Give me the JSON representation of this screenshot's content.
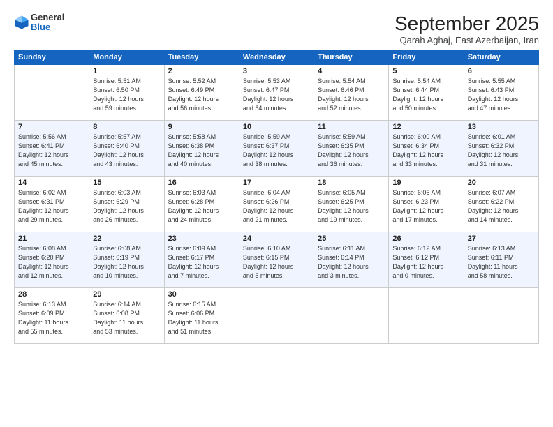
{
  "logo": {
    "general": "General",
    "blue": "Blue"
  },
  "header": {
    "month_year": "September 2025",
    "location": "Qarah Aghaj, East Azerbaijan, Iran"
  },
  "days_of_week": [
    "Sunday",
    "Monday",
    "Tuesday",
    "Wednesday",
    "Thursday",
    "Friday",
    "Saturday"
  ],
  "weeks": [
    [
      {
        "day": "",
        "info": ""
      },
      {
        "day": "1",
        "info": "Sunrise: 5:51 AM\nSunset: 6:50 PM\nDaylight: 12 hours\nand 59 minutes."
      },
      {
        "day": "2",
        "info": "Sunrise: 5:52 AM\nSunset: 6:49 PM\nDaylight: 12 hours\nand 56 minutes."
      },
      {
        "day": "3",
        "info": "Sunrise: 5:53 AM\nSunset: 6:47 PM\nDaylight: 12 hours\nand 54 minutes."
      },
      {
        "day": "4",
        "info": "Sunrise: 5:54 AM\nSunset: 6:46 PM\nDaylight: 12 hours\nand 52 minutes."
      },
      {
        "day": "5",
        "info": "Sunrise: 5:54 AM\nSunset: 6:44 PM\nDaylight: 12 hours\nand 50 minutes."
      },
      {
        "day": "6",
        "info": "Sunrise: 5:55 AM\nSunset: 6:43 PM\nDaylight: 12 hours\nand 47 minutes."
      }
    ],
    [
      {
        "day": "7",
        "info": "Sunrise: 5:56 AM\nSunset: 6:41 PM\nDaylight: 12 hours\nand 45 minutes."
      },
      {
        "day": "8",
        "info": "Sunrise: 5:57 AM\nSunset: 6:40 PM\nDaylight: 12 hours\nand 43 minutes."
      },
      {
        "day": "9",
        "info": "Sunrise: 5:58 AM\nSunset: 6:38 PM\nDaylight: 12 hours\nand 40 minutes."
      },
      {
        "day": "10",
        "info": "Sunrise: 5:59 AM\nSunset: 6:37 PM\nDaylight: 12 hours\nand 38 minutes."
      },
      {
        "day": "11",
        "info": "Sunrise: 5:59 AM\nSunset: 6:35 PM\nDaylight: 12 hours\nand 36 minutes."
      },
      {
        "day": "12",
        "info": "Sunrise: 6:00 AM\nSunset: 6:34 PM\nDaylight: 12 hours\nand 33 minutes."
      },
      {
        "day": "13",
        "info": "Sunrise: 6:01 AM\nSunset: 6:32 PM\nDaylight: 12 hours\nand 31 minutes."
      }
    ],
    [
      {
        "day": "14",
        "info": "Sunrise: 6:02 AM\nSunset: 6:31 PM\nDaylight: 12 hours\nand 29 minutes."
      },
      {
        "day": "15",
        "info": "Sunrise: 6:03 AM\nSunset: 6:29 PM\nDaylight: 12 hours\nand 26 minutes."
      },
      {
        "day": "16",
        "info": "Sunrise: 6:03 AM\nSunset: 6:28 PM\nDaylight: 12 hours\nand 24 minutes."
      },
      {
        "day": "17",
        "info": "Sunrise: 6:04 AM\nSunset: 6:26 PM\nDaylight: 12 hours\nand 21 minutes."
      },
      {
        "day": "18",
        "info": "Sunrise: 6:05 AM\nSunset: 6:25 PM\nDaylight: 12 hours\nand 19 minutes."
      },
      {
        "day": "19",
        "info": "Sunrise: 6:06 AM\nSunset: 6:23 PM\nDaylight: 12 hours\nand 17 minutes."
      },
      {
        "day": "20",
        "info": "Sunrise: 6:07 AM\nSunset: 6:22 PM\nDaylight: 12 hours\nand 14 minutes."
      }
    ],
    [
      {
        "day": "21",
        "info": "Sunrise: 6:08 AM\nSunset: 6:20 PM\nDaylight: 12 hours\nand 12 minutes."
      },
      {
        "day": "22",
        "info": "Sunrise: 6:08 AM\nSunset: 6:19 PM\nDaylight: 12 hours\nand 10 minutes."
      },
      {
        "day": "23",
        "info": "Sunrise: 6:09 AM\nSunset: 6:17 PM\nDaylight: 12 hours\nand 7 minutes."
      },
      {
        "day": "24",
        "info": "Sunrise: 6:10 AM\nSunset: 6:15 PM\nDaylight: 12 hours\nand 5 minutes."
      },
      {
        "day": "25",
        "info": "Sunrise: 6:11 AM\nSunset: 6:14 PM\nDaylight: 12 hours\nand 3 minutes."
      },
      {
        "day": "26",
        "info": "Sunrise: 6:12 AM\nSunset: 6:12 PM\nDaylight: 12 hours\nand 0 minutes."
      },
      {
        "day": "27",
        "info": "Sunrise: 6:13 AM\nSunset: 6:11 PM\nDaylight: 11 hours\nand 58 minutes."
      }
    ],
    [
      {
        "day": "28",
        "info": "Sunrise: 6:13 AM\nSunset: 6:09 PM\nDaylight: 11 hours\nand 55 minutes."
      },
      {
        "day": "29",
        "info": "Sunrise: 6:14 AM\nSunset: 6:08 PM\nDaylight: 11 hours\nand 53 minutes."
      },
      {
        "day": "30",
        "info": "Sunrise: 6:15 AM\nSunset: 6:06 PM\nDaylight: 11 hours\nand 51 minutes."
      },
      {
        "day": "",
        "info": ""
      },
      {
        "day": "",
        "info": ""
      },
      {
        "day": "",
        "info": ""
      },
      {
        "day": "",
        "info": ""
      }
    ]
  ]
}
